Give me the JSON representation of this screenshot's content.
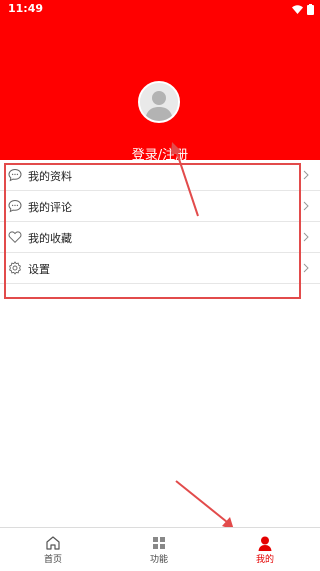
{
  "status_bar": {
    "time": "11:49"
  },
  "header": {
    "login_label": "登录/注册",
    "avatar_icon": "avatar-placeholder-icon"
  },
  "menu": {
    "items": [
      {
        "label": "我的资料",
        "icon": "chat-bubble-icon"
      },
      {
        "label": "我的评论",
        "icon": "chat-bubble-icon"
      },
      {
        "label": "我的收藏",
        "icon": "heart-icon"
      },
      {
        "label": "设置",
        "icon": "gear-icon"
      }
    ]
  },
  "bottom_nav": {
    "items": [
      {
        "label": "首页",
        "icon": "home-icon"
      },
      {
        "label": "功能",
        "icon": "grid-icon"
      },
      {
        "label": "我的",
        "icon": "person-icon",
        "active": true
      }
    ]
  },
  "colors": {
    "brand": "#ff0000",
    "annotation": "#e24b4b",
    "active_nav": "#e40000"
  }
}
